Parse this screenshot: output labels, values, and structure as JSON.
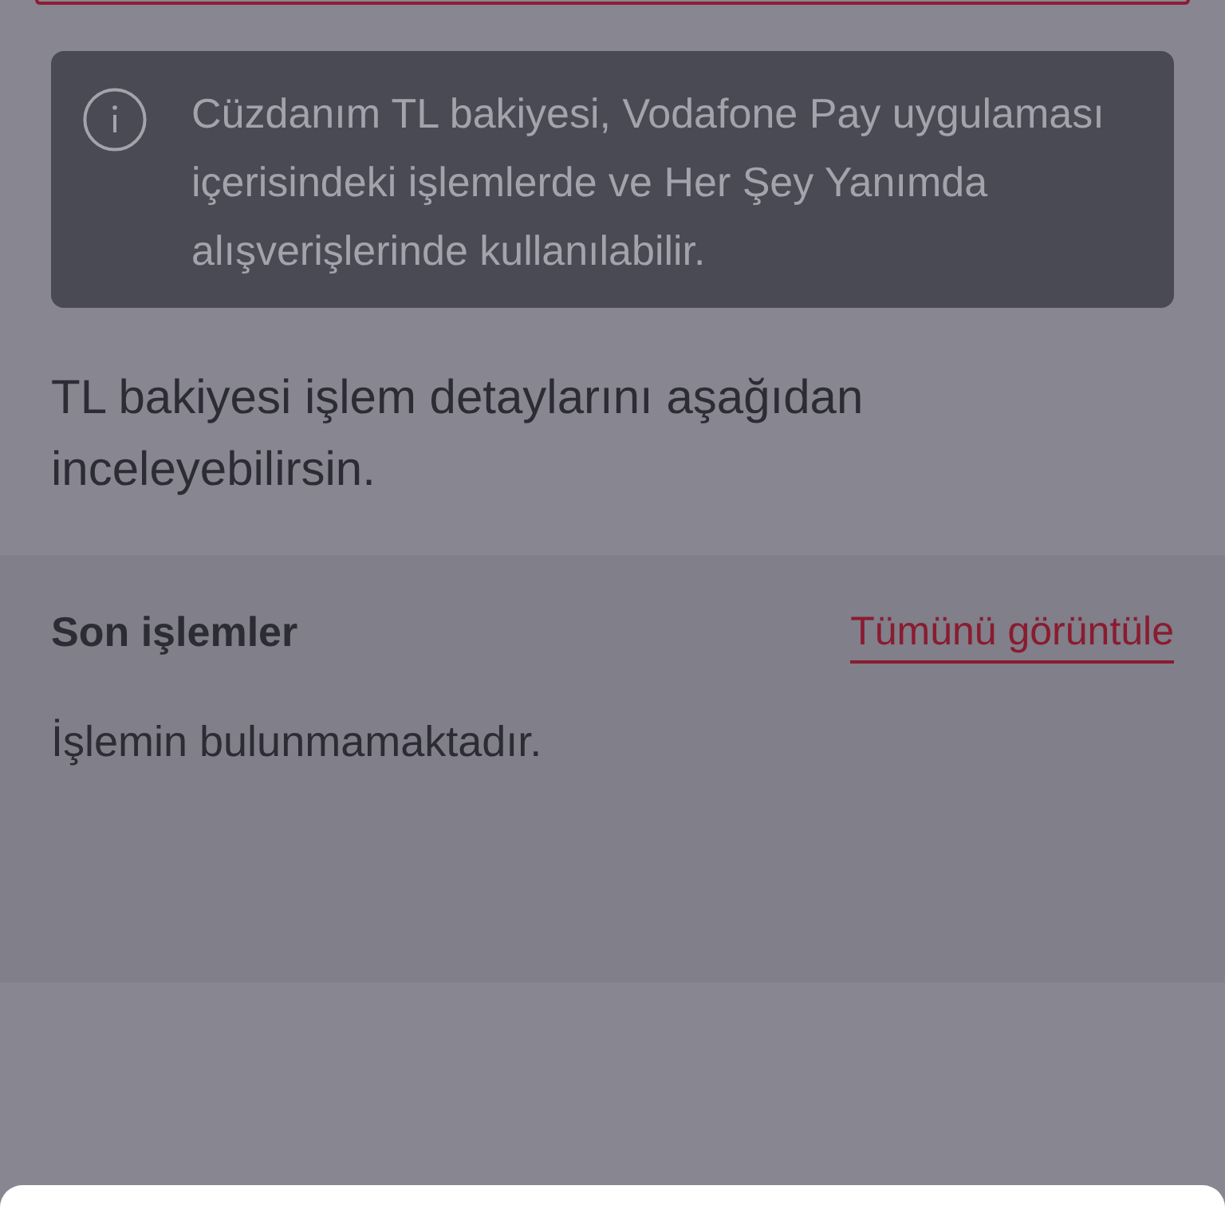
{
  "info_card": {
    "text": "Cüzdanım TL bakiyesi, Vodafone Pay uygulaması içerisindeki işlemlerde ve Her Şey Yanımda alışverişlerinde kullanılabilir."
  },
  "description": "TL bakiyesi işlem detaylarını aşağıdan inceleyebilirsin.",
  "recent_transactions": {
    "title": "Son işlemler",
    "view_all_link": "Tümünü görüntüle",
    "empty_message": "İşlemin bulunmamaktadır."
  }
}
